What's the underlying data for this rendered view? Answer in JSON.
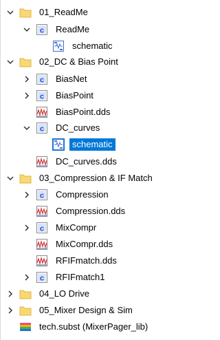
{
  "tree": {
    "items": [
      {
        "id": "readme-folder",
        "label": "01_ReadMe",
        "type": "folder",
        "expanded": true,
        "level": 0
      },
      {
        "id": "readme-cell",
        "label": "ReadMe",
        "type": "cell",
        "expanded": true,
        "level": 1
      },
      {
        "id": "readme-schematic",
        "label": "schematic",
        "type": "schematic",
        "level": 2
      },
      {
        "id": "dc-folder",
        "label": "02_DC & Bias Point",
        "type": "folder",
        "expanded": true,
        "level": 0
      },
      {
        "id": "biasnet-cell",
        "label": "BiasNet",
        "type": "cell",
        "expanded": false,
        "level": 1
      },
      {
        "id": "biaspoint-cell",
        "label": "BiasPoint",
        "type": "cell",
        "expanded": false,
        "level": 1
      },
      {
        "id": "biaspoint-dds",
        "label": "BiasPoint.dds",
        "type": "dds",
        "level": 1
      },
      {
        "id": "dccurves-cell",
        "label": "DC_curves",
        "type": "cell",
        "expanded": true,
        "level": 1
      },
      {
        "id": "dccurves-schematic",
        "label": "schematic",
        "type": "schematic",
        "level": 2,
        "selected": true
      },
      {
        "id": "dccurves-dds",
        "label": "DC_curves.dds",
        "type": "dds",
        "level": 1
      },
      {
        "id": "compression-folder",
        "label": "03_Compression & IF Match",
        "type": "folder",
        "expanded": true,
        "level": 0
      },
      {
        "id": "compression-cell",
        "label": "Compression",
        "type": "cell",
        "expanded": false,
        "level": 1
      },
      {
        "id": "compression-dds",
        "label": "Compression.dds",
        "type": "dds",
        "level": 1
      },
      {
        "id": "mixcompr-cell",
        "label": "MixCompr",
        "type": "cell",
        "expanded": false,
        "level": 1
      },
      {
        "id": "mixcompr-dds",
        "label": "MixCompr.dds",
        "type": "dds",
        "level": 1
      },
      {
        "id": "rfifmatch-dds",
        "label": "RFIFmatch.dds",
        "type": "dds",
        "level": 1
      },
      {
        "id": "rfifmatch1-cell",
        "label": "RFIFmatch1",
        "type": "cell",
        "expanded": false,
        "level": 1
      },
      {
        "id": "lodrive-folder",
        "label": "04_LO Drive",
        "type": "folder",
        "expanded": false,
        "level": 0
      },
      {
        "id": "mixer-folder",
        "label": "05_Mixer Design & Sim",
        "type": "folder",
        "expanded": false,
        "level": 0
      },
      {
        "id": "tech-subst",
        "label": "tech.subst (MixerPager_lib)",
        "type": "subst",
        "level": 0
      }
    ]
  },
  "icons": {
    "expanded": "chevron-down-icon",
    "collapsed": "chevron-right-icon",
    "folder": "folder-icon",
    "cell": "cell-icon",
    "schematic": "schematic-icon",
    "dds": "dds-icon",
    "subst": "substrate-icon"
  },
  "colors": {
    "selection": "#0078d7",
    "folder": "#f8d775",
    "folder_dark": "#e0b440",
    "cell_blue": "#1f4fbf",
    "chevron": "#333333"
  }
}
